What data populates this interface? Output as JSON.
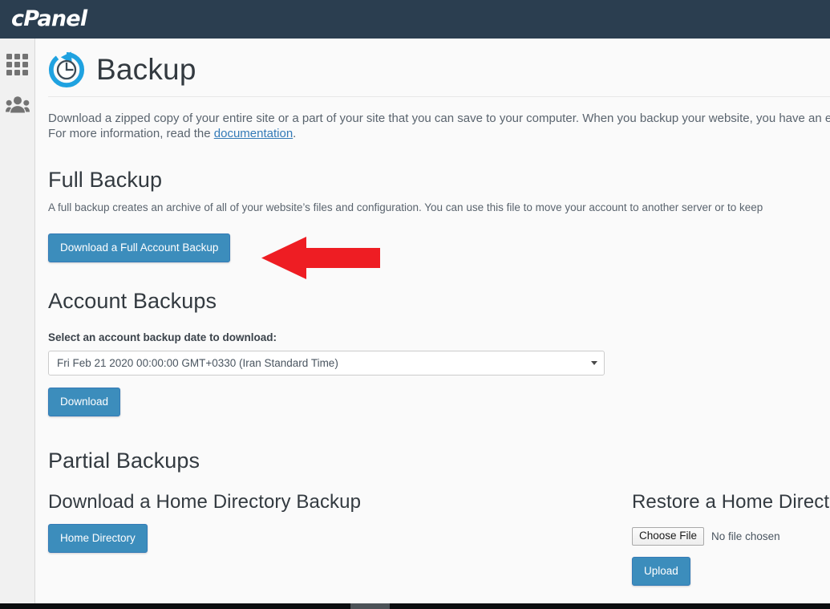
{
  "header": {
    "brand": "cPanel",
    "bg_color": "#2b3e50"
  },
  "sidebar": {
    "items": [
      {
        "name": "grid-apps",
        "icon": "grid-icon",
        "label": ""
      },
      {
        "name": "user-manager",
        "icon": "people-icon",
        "label": ""
      }
    ]
  },
  "page": {
    "title": "Backup",
    "icon": "backup-restore-clock-icon",
    "description_line1": "Download a zipped copy of your entire site or a part of your site that you can save to your computer. When you backup your website, you have an extr",
    "description_line2_pre": "For more information, read the ",
    "description_link": "documentation",
    "description_line2_post": "."
  },
  "full_backup": {
    "heading": "Full Backup",
    "paragraph": "A full backup creates an archive of all of your website’s files and configuration. You can use this file to move your account to another server or to keep",
    "button_label": "Download a Full Account Backup"
  },
  "annotation": {
    "arrow_color": "#ee1d23",
    "arrow_direction": "left",
    "points_at": "download-full-account-backup-button"
  },
  "account_backups": {
    "heading": "Account Backups",
    "select_label": "Select an account backup date to download:",
    "selected_date": "Fri Feb 21 2020 00:00:00 GMT+0330 (Iran Standard Time)",
    "options": [
      "Fri Feb 21 2020 00:00:00 GMT+0330 (Iran Standard Time)"
    ],
    "download_button_label": "Download"
  },
  "partial_backups": {
    "heading": "Partial Backups",
    "left": {
      "heading": "Download a Home Directory Backup",
      "button_label": "Home Directory"
    },
    "right": {
      "heading": "Restore a Home Direct",
      "choose_file_label": "Choose File",
      "no_file_text": "No file chosen",
      "upload_button_label": "Upload"
    }
  },
  "colors": {
    "primary_button": "#3c8dbc",
    "link": "#337ab7",
    "header_bg": "#2b3e50",
    "text": "#333a40"
  }
}
